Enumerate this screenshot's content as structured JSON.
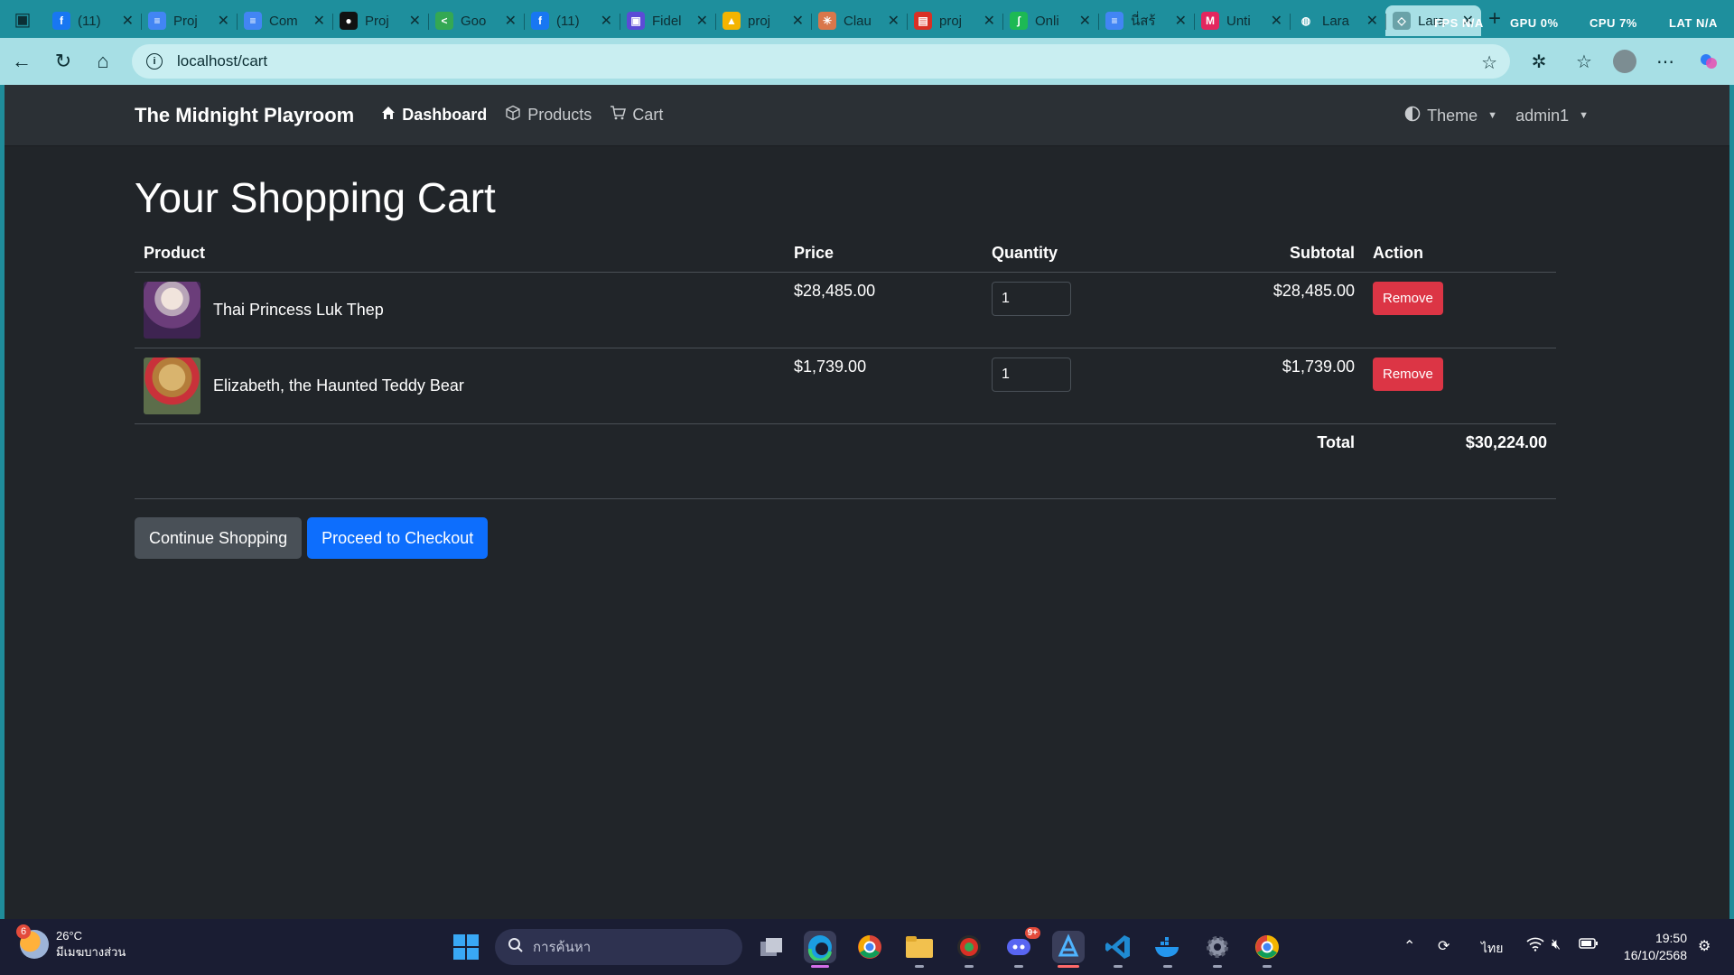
{
  "browser": {
    "tabs": [
      {
        "title": "(11)",
        "icon": "facebook-icon",
        "color": "#1877f2",
        "glyph": "f"
      },
      {
        "title": "Proj",
        "icon": "docs-icon",
        "color": "#4285f4",
        "glyph": "≡"
      },
      {
        "title": "Com",
        "icon": "docs-icon",
        "color": "#4285f4",
        "glyph": "≡"
      },
      {
        "title": "Proj",
        "icon": "github-icon",
        "color": "#111111",
        "glyph": "●"
      },
      {
        "title": "Goo",
        "icon": "google-icon",
        "color": "#34a853",
        "glyph": "<"
      },
      {
        "title": "(11)",
        "icon": "facebook-icon",
        "color": "#1877f2",
        "glyph": "f"
      },
      {
        "title": "Fidel",
        "icon": "doc-icon",
        "color": "#5b4bd6",
        "glyph": "▣"
      },
      {
        "title": "proj",
        "icon": "drive-icon",
        "color": "#f4b400",
        "glyph": "▲"
      },
      {
        "title": "Clau",
        "icon": "claude-icon",
        "color": "#d9774b",
        "glyph": "✳"
      },
      {
        "title": "proj",
        "icon": "pdf-icon",
        "color": "#d93025",
        "glyph": "▤"
      },
      {
        "title": "Onli",
        "icon": "online-icon",
        "color": "#1db954",
        "glyph": "ʃ"
      },
      {
        "title": "นี่สร้",
        "icon": "docs-icon",
        "color": "#4285f4",
        "glyph": "≡"
      },
      {
        "title": "Unti",
        "icon": "miro-icon",
        "color": "#e3265e",
        "glyph": "M"
      },
      {
        "title": "Lara",
        "icon": "globe-icon",
        "color": "#1e8f9d",
        "glyph": "◍"
      },
      {
        "title": "Lara",
        "icon": "laravel-icon",
        "color": "#6aa2a8",
        "glyph": "◇"
      }
    ],
    "overlay": {
      "fps_label": "FPS",
      "fps_value": "N/A",
      "gpu_label": "GPU",
      "gpu_value": "0%",
      "cpu_label": "CPU",
      "cpu_value": "7%",
      "lat_label": "LAT",
      "lat_value": "N/A"
    },
    "url": "localhost/cart"
  },
  "site": {
    "brand": "The Midnight Playroom",
    "nav": {
      "dashboard": "Dashboard",
      "products": "Products",
      "cart": "Cart",
      "theme": "Theme",
      "user": "admin1"
    },
    "page_title": "Your Shopping Cart",
    "table": {
      "headers": {
        "product": "Product",
        "price": "Price",
        "quantity": "Quantity",
        "subtotal": "Subtotal",
        "action": "Action"
      },
      "rows": [
        {
          "name": "Thai Princess Luk Thep",
          "price": "$28,485.00",
          "quantity": "1",
          "subtotal": "$28,485.00",
          "action": "Remove"
        },
        {
          "name": "Elizabeth, the Haunted Teddy Bear",
          "price": "$1,739.00",
          "quantity": "1",
          "subtotal": "$1,739.00",
          "action": "Remove"
        }
      ],
      "total_label": "Total",
      "total_value": "$30,224.00"
    },
    "buttons": {
      "continue": "Continue Shopping",
      "checkout": "Proceed to Checkout"
    }
  },
  "taskbar": {
    "weather": {
      "temp": "26°C",
      "desc": "มีเมฆบางส่วน",
      "badge": "6"
    },
    "search_placeholder": "การค้นหา",
    "discord_badge": "9+",
    "language": "ไทย",
    "time": "19:50",
    "date": "16/10/2568"
  }
}
